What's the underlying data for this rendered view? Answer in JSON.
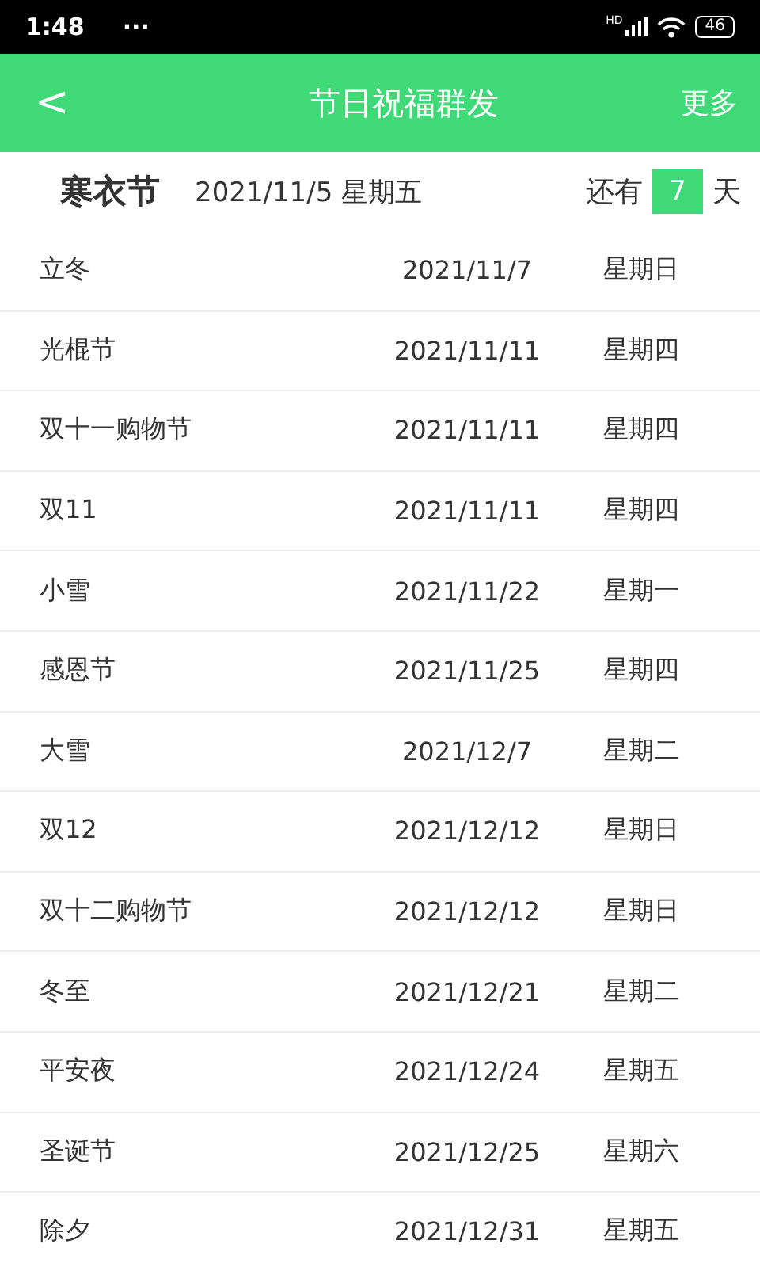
{
  "status_bar": {
    "time": "1:48",
    "dots": "···",
    "signal_label": "HD",
    "battery": "46"
  },
  "header": {
    "back": "<",
    "title": "节日祝福群发",
    "action": "更多"
  },
  "featured": {
    "name": "寒衣节",
    "date": "2021/11/5 星期五",
    "prefix": "还有",
    "days": "7",
    "suffix": "天"
  },
  "holidays": [
    {
      "name": "立冬",
      "date": "2021/11/7",
      "weekday": "星期日"
    },
    {
      "name": "光棍节",
      "date": "2021/11/11",
      "weekday": "星期四"
    },
    {
      "name": "双十一购物节",
      "date": "2021/11/11",
      "weekday": "星期四"
    },
    {
      "name": "双11",
      "date": "2021/11/11",
      "weekday": "星期四"
    },
    {
      "name": "小雪",
      "date": "2021/11/22",
      "weekday": "星期一"
    },
    {
      "name": "感恩节",
      "date": "2021/11/25",
      "weekday": "星期四"
    },
    {
      "name": "大雪",
      "date": "2021/12/7",
      "weekday": "星期二"
    },
    {
      "name": "双12",
      "date": "2021/12/12",
      "weekday": "星期日"
    },
    {
      "name": "双十二购物节",
      "date": "2021/12/12",
      "weekday": "星期日"
    },
    {
      "name": "冬至",
      "date": "2021/12/21",
      "weekday": "星期二"
    },
    {
      "name": "平安夜",
      "date": "2021/12/24",
      "weekday": "星期五"
    },
    {
      "name": "圣诞节",
      "date": "2021/12/25",
      "weekday": "星期六"
    },
    {
      "name": "除夕",
      "date": "2021/12/31",
      "weekday": "星期五"
    }
  ]
}
